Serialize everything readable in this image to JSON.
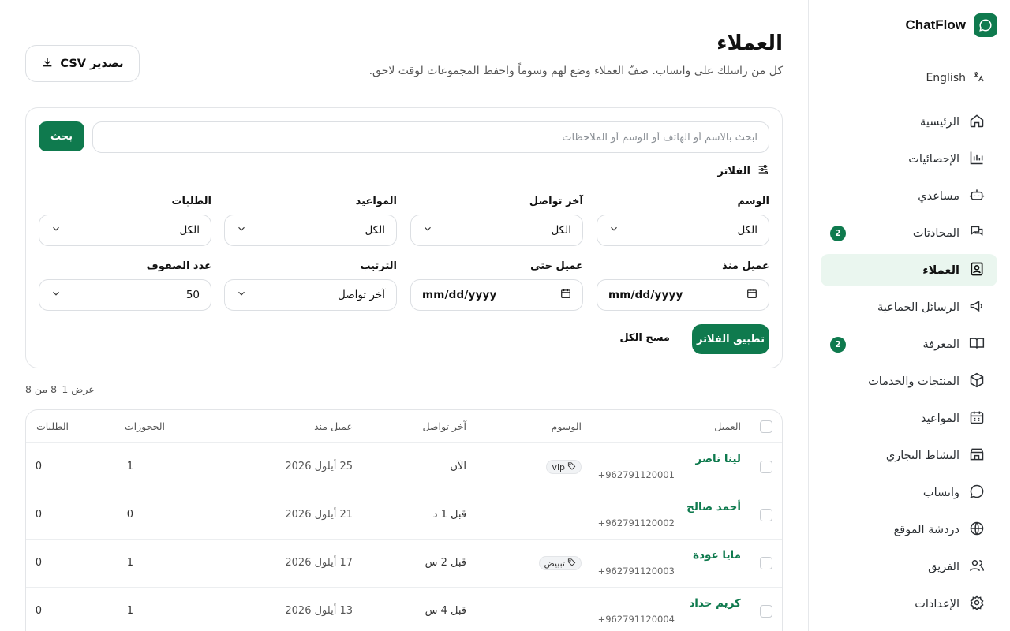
{
  "brand": {
    "name": "ChatFlow"
  },
  "language_toggle": {
    "label": "English"
  },
  "nav": {
    "items": [
      {
        "label": "الرئيسية",
        "icon": "home-icon"
      },
      {
        "label": "الإحصائيات",
        "icon": "chart-icon"
      },
      {
        "label": "مساعدي",
        "icon": "bot-icon"
      },
      {
        "label": "المحادثات",
        "icon": "chat-icon",
        "badge": "2"
      },
      {
        "label": "العملاء",
        "icon": "contacts-icon",
        "active": true
      },
      {
        "label": "الرسائل الجماعية",
        "icon": "megaphone-icon"
      },
      {
        "label": "المعرفة",
        "icon": "book-icon",
        "badge": "2"
      },
      {
        "label": "المنتجات والخدمات",
        "icon": "box-icon"
      },
      {
        "label": "المواعيد",
        "icon": "calendar-icon"
      },
      {
        "label": "النشاط التجاري",
        "icon": "store-icon"
      },
      {
        "label": "واتساب",
        "icon": "whatsapp-icon"
      },
      {
        "label": "دردشة الموقع",
        "icon": "globe-icon"
      },
      {
        "label": "الفريق",
        "icon": "team-icon"
      },
      {
        "label": "الإعدادات",
        "icon": "gear-icon"
      }
    ]
  },
  "header": {
    "title": "العملاء",
    "subtitle": "كل من راسلك على واتساب. صفّ العملاء وضع لهم وسوماً واحفظ المجموعات لوقت لاحق.",
    "export_label": "تصدير CSV"
  },
  "search": {
    "placeholder": "ابحث بالاسم أو الهاتف أو الوسم أو الملاحظات",
    "value": "",
    "button_label": "بحث"
  },
  "filters": {
    "title": "الفلاتر",
    "tag": {
      "label": "الوسم",
      "value": "الكل"
    },
    "last_contact": {
      "label": "آخر تواصل",
      "value": "الكل"
    },
    "appointments": {
      "label": "المواعيد",
      "value": "الكل"
    },
    "orders": {
      "label": "الطلبات",
      "value": "الكل"
    },
    "customer_since": {
      "label": "عميل منذ",
      "value": "mm/dd/yyyy"
    },
    "customer_until": {
      "label": "عميل حتى",
      "value": "mm/dd/yyyy"
    },
    "sort": {
      "label": "الترتيب",
      "value": "آخر تواصل"
    },
    "rows": {
      "label": "عدد الصفوف",
      "value": "50"
    },
    "apply_label": "تطبيق الفلاتر",
    "clear_label": "مسح الكل"
  },
  "results": {
    "count_text": "عرض 1–8 من 8"
  },
  "table": {
    "headers": {
      "customer": "العميل",
      "tags": "الوسوم",
      "last_contact": "آخر تواصل",
      "customer_since": "عميل منذ",
      "bookings": "الحجوزات",
      "orders": "الطلبات"
    },
    "rows": [
      {
        "name": "لينا ناصر",
        "phone": "+962791120001",
        "tag": "vip",
        "last_contact": "الآن",
        "since": "25 أيلول 2026",
        "bookings": "1",
        "orders": "0"
      },
      {
        "name": "أحمد صالح",
        "phone": "+962791120002",
        "tag": "",
        "last_contact": "قبل 1 د",
        "since": "21 أيلول 2026",
        "bookings": "0",
        "orders": "0"
      },
      {
        "name": "مايا عودة",
        "phone": "+962791120003",
        "tag": "تبييض",
        "last_contact": "قبل 2 س",
        "since": "17 أيلول 2026",
        "bookings": "1",
        "orders": "0"
      },
      {
        "name": "كريم حداد",
        "phone": "+962791120004",
        "tag": "",
        "last_contact": "قبل 4 س",
        "since": "13 أيلول 2026",
        "bookings": "1",
        "orders": "0"
      }
    ]
  },
  "colors": {
    "accent": "#0f7a4e",
    "active_bg": "#eaf6ef"
  }
}
